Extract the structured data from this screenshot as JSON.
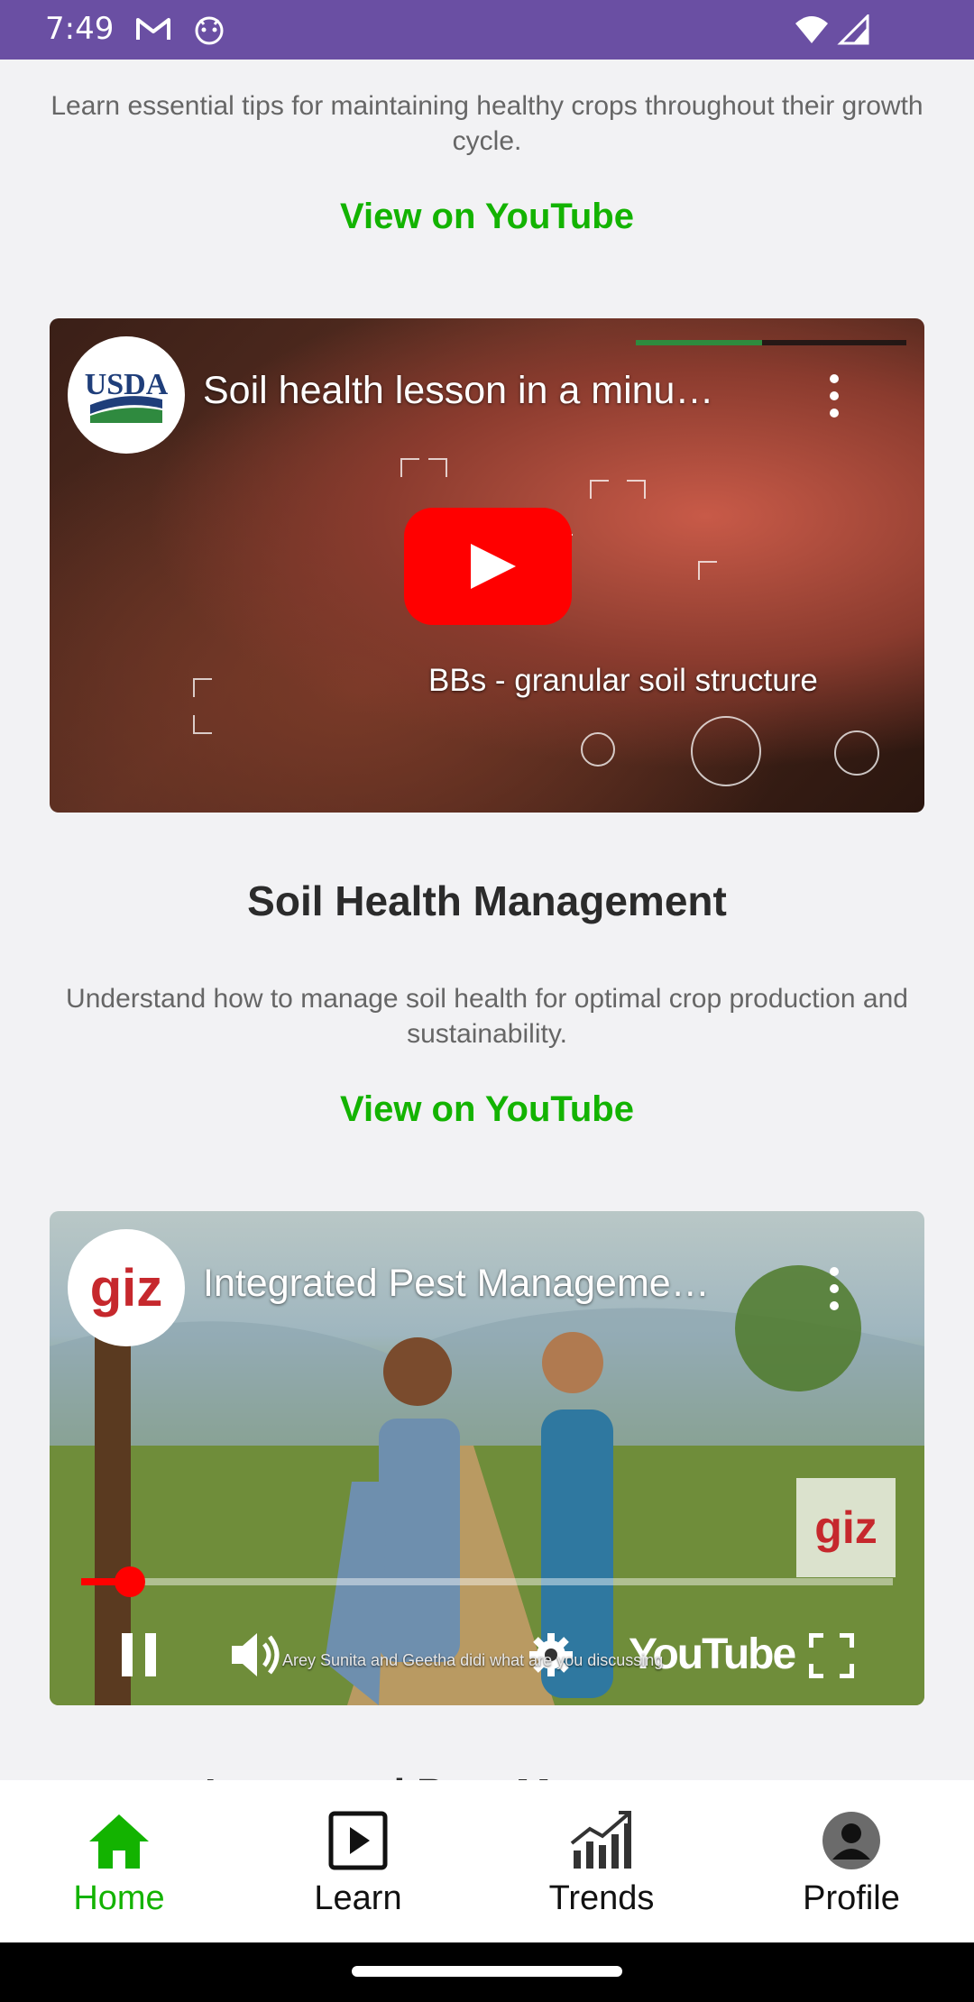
{
  "status_bar": {
    "time": "7:49"
  },
  "sections": [
    {
      "description": "Learn essential tips for maintaining healthy crops throughout their growth cycle.",
      "link_label": "View on YouTube"
    },
    {
      "title": "Soil Health Management",
      "description": "Understand how to manage soil health for optimal crop production and sustainability.",
      "link_label": "View on YouTube"
    },
    {
      "title": "Integrated Pest Management"
    }
  ],
  "videos": [
    {
      "channel": "USDA",
      "title": "Soil health lesson in a minu…",
      "overlay_text": "BBs - granular soil structure"
    },
    {
      "channel": "giz",
      "title": "Integrated Pest Manageme…",
      "caption": "Arey Sunita and Geetha didi what are you discussing",
      "watermark": "giz",
      "progress": 0.06,
      "youtube_wordmark": "YouTube"
    }
  ],
  "nav": {
    "items": [
      {
        "label": "Home",
        "icon": "home-icon",
        "active": true
      },
      {
        "label": "Learn",
        "icon": "play-square-icon",
        "active": false
      },
      {
        "label": "Trends",
        "icon": "chart-icon",
        "active": false
      },
      {
        "label": "Profile",
        "icon": "person-icon",
        "active": false
      }
    ]
  },
  "colors": {
    "status_bar": "#6a4fa3",
    "link_green": "#13b300",
    "youtube_red": "#ff0000"
  }
}
